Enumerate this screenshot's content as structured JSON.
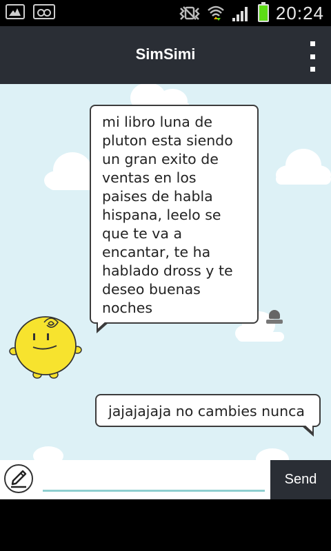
{
  "status_bar": {
    "time": "20:24",
    "icons": [
      "photo-icon",
      "voicemail-icon",
      "vibrate-mute-icon",
      "wifi-icon",
      "signal-icon",
      "battery-icon"
    ],
    "battery_color": "#5ddc16"
  },
  "header": {
    "title": "SimSimi",
    "menu_icon": "overflow-menu-icon",
    "background": "#2a2e35"
  },
  "chat": {
    "background": "#ddf1f6",
    "messages": [
      {
        "sender": "simsimi",
        "lines": [
          "mi libro luna de",
          "pluton esta siendo",
          "un gran exito de",
          "ventas en los",
          "paises de habla",
          "hispana, leelo se",
          "que te va a",
          "encantar, te ha",
          "hablado dross y te",
          "deseo buenas",
          "noches"
        ]
      },
      {
        "sender": "user",
        "text": "jajajajaja no cambies nunca"
      }
    ],
    "report_icon": "siren-report-icon",
    "mascot_icon": "simsimi-mascot-icon"
  },
  "input_bar": {
    "value": "",
    "placeholder": "",
    "send_label": "Send",
    "pencil_icon": "pencil-icon",
    "accent": "#8fcfd0"
  }
}
